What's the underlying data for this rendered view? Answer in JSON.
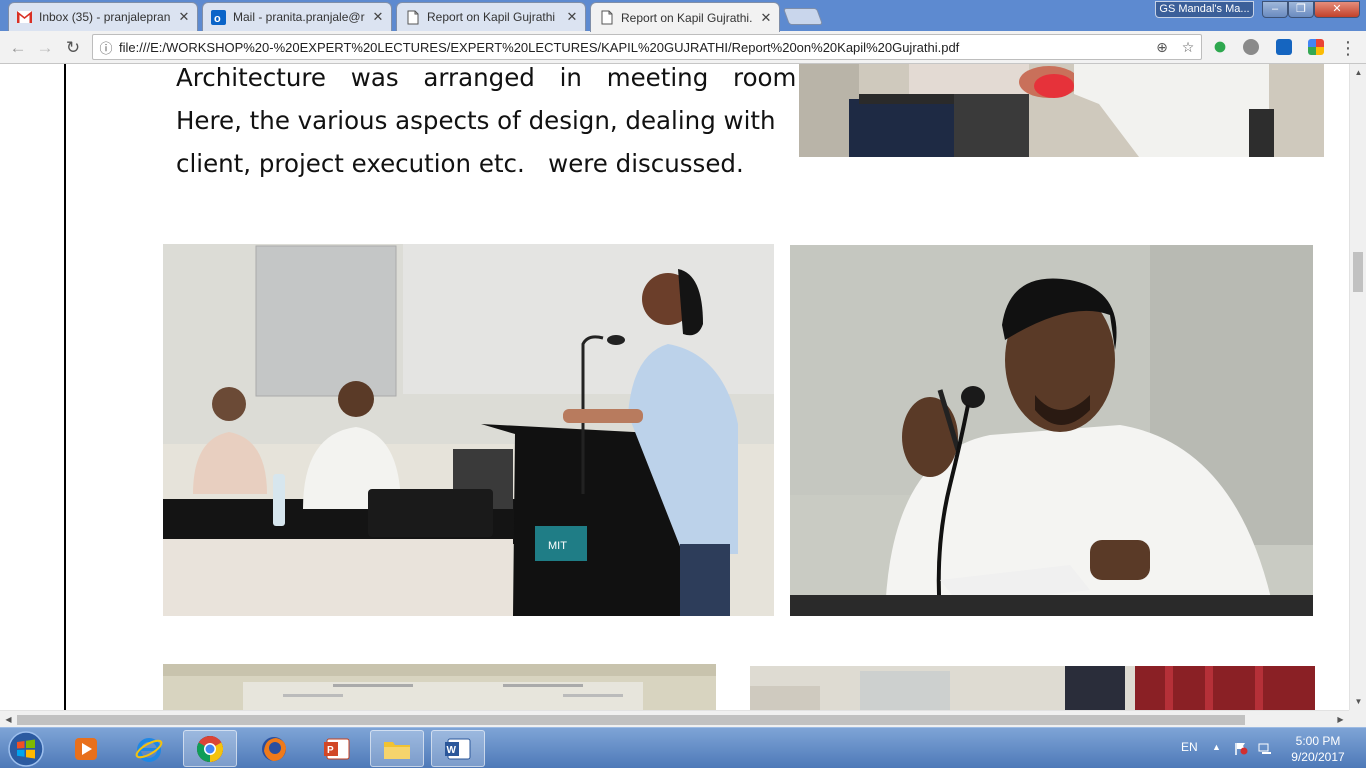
{
  "browser": {
    "tabs": [
      {
        "title": "Inbox (35) - pranjalepran",
        "icon": "gmail-icon",
        "active": false
      },
      {
        "title": "Mail - pranita.pranjale@r",
        "icon": "outlook-icon",
        "active": false
      },
      {
        "title": "Report on Kapil Gujrathi",
        "icon": "document-icon",
        "active": false
      },
      {
        "title": "Report on Kapil Gujrathi.",
        "icon": "document-icon",
        "active": true
      }
    ],
    "profile_label": "GS Mandal's Ma...",
    "window_buttons": {
      "minimize": "‒",
      "restore": "❐",
      "close": "✕"
    },
    "url": "file:///E:/WORKSHOP%20-%20EXPERT%20LECTURES/EXPERT%20LECTURES/KAPIL%20GUJRATHI/Report%20on%20Kapil%20Gujrathi.pdf",
    "nav": {
      "back": "←",
      "forward": "→",
      "reload": "↻"
    },
    "omnibox_icons": {
      "info": "ⓘ",
      "zoom": "⊕",
      "star": "☆"
    },
    "extensions": [
      "green-extension-icon",
      "grey-extension-icon",
      "blue-extension-icon",
      "multicolor-extension-icon"
    ],
    "menu_icon": "⋮",
    "colors": {
      "tabstrip": "#5d8ad0",
      "taskbar": "#4e79b8"
    }
  },
  "document": {
    "paragraph_lines": [
      "Architecture was arranged in meeting room.",
      "Here, the various aspects of design, dealing with",
      "client, project execution etc.   were discussed."
    ],
    "photos": [
      {
        "name": "photo-handshake",
        "alt": "handshake photo"
      },
      {
        "name": "photo-speaker-podium",
        "alt": "woman speaking at MIT podium"
      },
      {
        "name": "photo-speaker-mic",
        "alt": "man speaking into microphone"
      },
      {
        "name": "photo-hall",
        "alt": "lecture hall"
      },
      {
        "name": "photo-room",
        "alt": "room with curtains"
      }
    ],
    "podium_sign": "MIT"
  },
  "taskbar": {
    "items": [
      "windows-media-player-icon",
      "internet-explorer-icon",
      "chrome-icon",
      "firefox-icon",
      "powerpoint-icon",
      "file-explorer-icon",
      "word-icon"
    ],
    "language": "EN",
    "time": "5:00 PM",
    "date": "9/20/2017"
  }
}
